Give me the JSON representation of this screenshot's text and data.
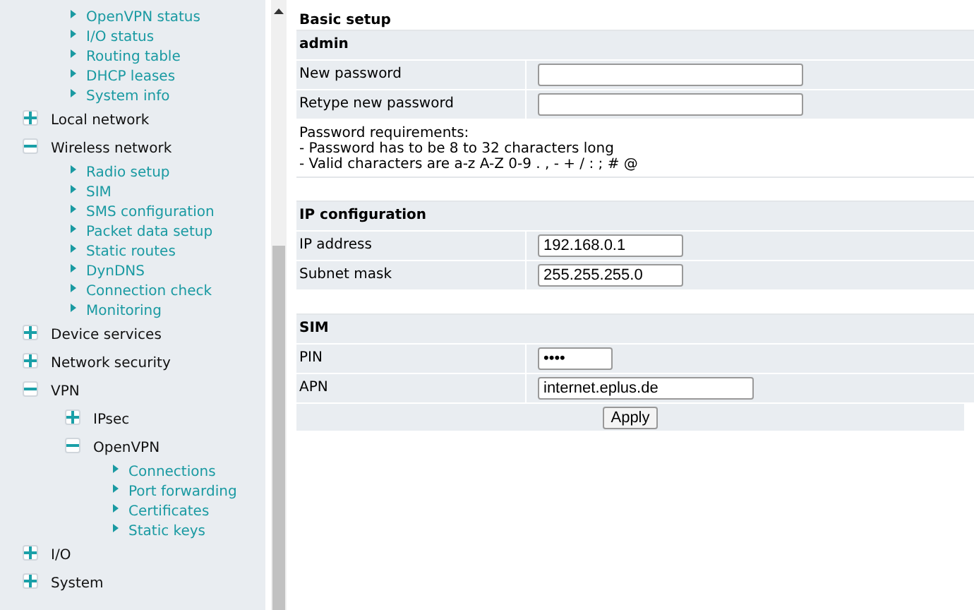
{
  "sidebar": {
    "status_links": [
      "OpenVPN status",
      "I/O status",
      "Routing table",
      "DHCP leases",
      "System info"
    ],
    "tree": [
      {
        "label": "Local network",
        "expanded": false
      },
      {
        "label": "Wireless network",
        "expanded": true,
        "children": [
          {
            "label": "Radio setup"
          },
          {
            "label": "SIM"
          },
          {
            "label": "SMS configuration"
          },
          {
            "label": "Packet data setup"
          },
          {
            "label": "Static routes"
          },
          {
            "label": "DynDNS"
          },
          {
            "label": "Connection check"
          },
          {
            "label": "Monitoring"
          }
        ]
      },
      {
        "label": "Device services",
        "expanded": false
      },
      {
        "label": "Network security",
        "expanded": false
      },
      {
        "label": "VPN",
        "expanded": true,
        "children": [
          {
            "kind": "group",
            "label": "IPsec",
            "expanded": false
          },
          {
            "kind": "group",
            "label": "OpenVPN",
            "expanded": true,
            "children": [
              {
                "label": "Connections"
              },
              {
                "label": "Port forwarding"
              },
              {
                "label": "Certificates"
              },
              {
                "label": "Static keys"
              }
            ]
          }
        ]
      },
      {
        "label": "I/O",
        "expanded": false
      },
      {
        "label": "System",
        "expanded": false
      }
    ]
  },
  "form": {
    "title": "Basic setup",
    "sections": [
      {
        "heading": "admin",
        "fields": [
          {
            "label": "New password"
          },
          {
            "label": "Retype new password"
          }
        ],
        "notes": [
          "Password requirements:",
          "- Password has to be 8 to 32 characters long",
          "- Valid characters are a-z A-Z 0-9 . , - + / : ; # @"
        ]
      },
      {
        "heading": "IP configuration",
        "fields": [
          {
            "label": "IP address",
            "value": "192.168.0.1"
          },
          {
            "label": "Subnet mask",
            "value": "255.255.255.0"
          }
        ]
      },
      {
        "heading": "SIM",
        "fields": [
          {
            "label": "PIN",
            "value": "••••"
          },
          {
            "label": "APN",
            "value": "internet.eplus.de"
          }
        ]
      }
    ],
    "apply_button": "Apply"
  }
}
